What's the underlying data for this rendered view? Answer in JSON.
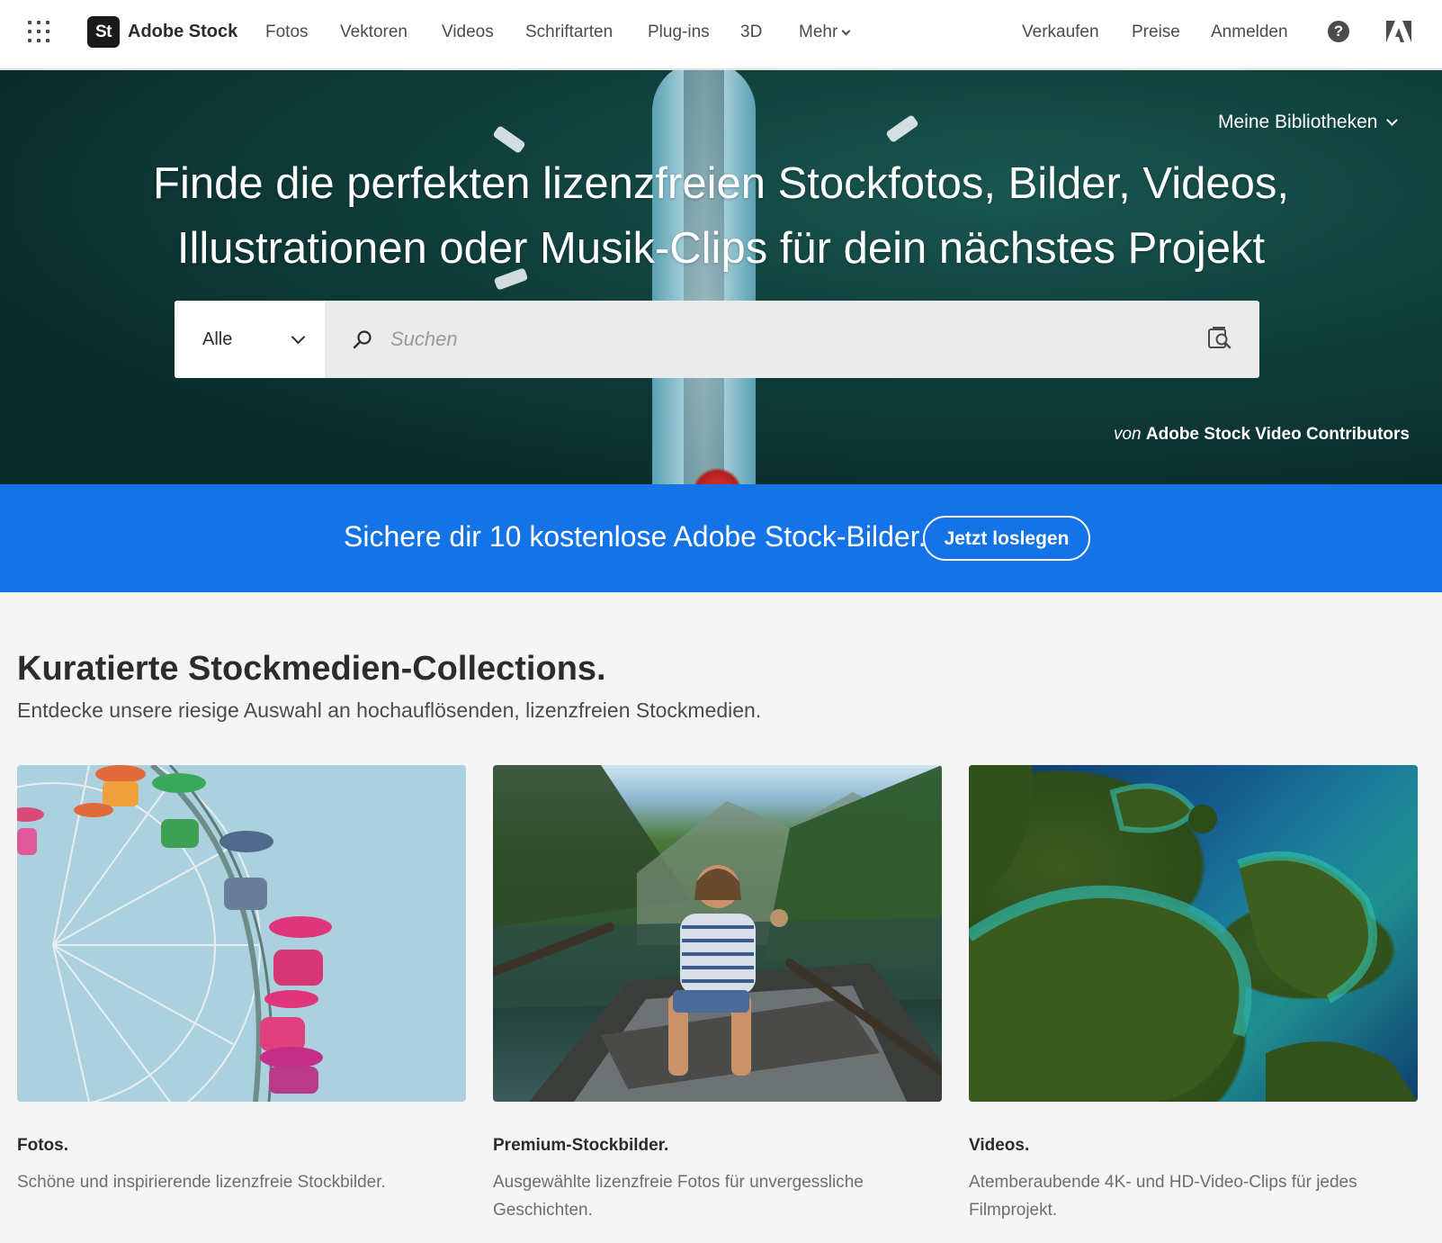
{
  "brand": {
    "mark": "St",
    "name": "Adobe Stock"
  },
  "nav": {
    "items": [
      "Fotos",
      "Vektoren",
      "Videos",
      "Schriftarten",
      "Plug-ins",
      "3D"
    ],
    "more": "Mehr",
    "right": [
      "Verkaufen",
      "Preise",
      "Anmelden"
    ],
    "help": "?"
  },
  "hero": {
    "libraries": "Meine Bibliotheken",
    "title_line1": "Finde die perfekten lizenzfreien Stockfotos, Bilder, Videos,",
    "title_line2": "Illustrationen oder Musik-Clips für dein nächstes Projekt",
    "search": {
      "category": "Alle",
      "placeholder": "Suchen"
    },
    "credit_prefix": "von",
    "credit_name": "Adobe Stock Video Contributors"
  },
  "promo": {
    "text": "Sichere dir 10 kostenlose Adobe Stock-Bilder.",
    "button": "Jetzt loslegen"
  },
  "collections": {
    "title": "Kuratierte Stockmedien-Collections.",
    "subtitle": "Entdecke unsere riesige Auswahl an hochauflösenden, lizenzfreien Stockmedien.",
    "cards": [
      {
        "title": "Fotos.",
        "desc": "Schöne und inspirierende lizenzfreie Stockbilder."
      },
      {
        "title": "Premium-Stockbilder.",
        "desc": "Ausgewählte lizenzfreie Fotos für unvergessliche Geschichten."
      },
      {
        "title": "Videos.",
        "desc": "Atemberaubende 4K- und HD-Video-Clips für jedes Filmprojekt."
      }
    ]
  },
  "colors": {
    "accent": "#1473e6",
    "hero_bg": "#0f3e3b",
    "text": "#2c2c2c"
  }
}
